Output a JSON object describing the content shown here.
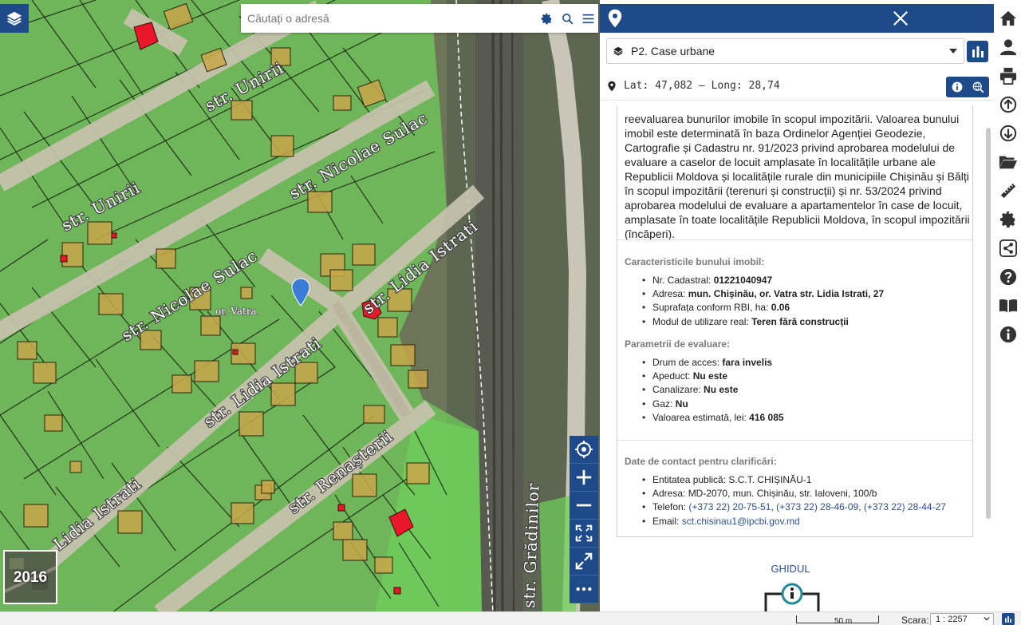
{
  "search": {
    "placeholder": "Căutați o adresă"
  },
  "map": {
    "streets": {
      "unirii_1": "str. Unirii",
      "unirii_2": "str. Unirii",
      "sulac_1": "str. Nicolae Sulac",
      "sulac_2": "str. Nicolae Sulac",
      "istrati_1": "str. Lidia Istrati",
      "istrati_2": "str. Lidia Istrati",
      "istrati_3": "Lidia Istrati",
      "renasterii": "str. Renașterii",
      "gradinilor": "str. Grădinilor"
    },
    "locality_label": "or. Vatra",
    "year_thumb": "2016"
  },
  "panel": {
    "layer_select": "P2. Case urbane",
    "coordinates": "Lat: 47,082 – Long: 28,74",
    "intro_text": "reevaluarea bunurilor imobile în scopul impozitării. Valoarea bunului imobil este determinată în baza Ordinelor Agenției Geodezie, Cartografie și Cadastru nr. 91/2023 privind aprobarea modelului de evaluare a caselor de locuit amplasate în localitățile urbane ale Republicii Moldova și localitățile rurale din municipiile Chișinău și Bălți în scopul impozitării (terenuri și construcții) și nr. 53/2024 privind aprobarea modelului de evaluare a apartamentelor în case de locuit, amplasate în toate localitățile Republicii Moldova, în scopul impozitării (încăperi).",
    "characteristics": {
      "title": "Caracteristicile bunului imobil:",
      "nr_label": "Nr. Cadastral: ",
      "nr_value": "01221040947",
      "address_label": "Adresa: ",
      "address_value": "mun. Chișinău, or. Vatra str. Lidia Istrati, 27",
      "area_label": "Suprafața conform RBI, ha: ",
      "area_value": "0.06",
      "use_label": "Modul de utilizare real: ",
      "use_value": "Teren fără construcții"
    },
    "evaluation": {
      "title": "Parametrii de evaluare:",
      "access_label": "Drum de acces: ",
      "access_value": "fara invelis",
      "water_label": "Apeduct: ",
      "water_value": "Nu este",
      "sewer_label": "Canalizare: ",
      "sewer_value": "Nu este",
      "gas_label": "Gaz: ",
      "gas_value": "Nu",
      "value_label": "Valoarea estimată, lei: ",
      "value_value": "416 085"
    },
    "contact": {
      "title": "Date de contact pentru clarificări:",
      "entity": "Entitatea publică: S.C.T. CHIȘINĂU-1",
      "address": "Adresa: MD-2070, mun. Chișinău, str. Ialoveni, 100/b",
      "phone_label": "Telefon: ",
      "phone_1": "(+373 22) 20-75-51",
      "phone_2": "(+373 22) 28-46-09",
      "phone_3": "(+373 22) 28-44-27",
      "sep": ", ",
      "email_label": "Email: ",
      "email": "sct.chisinau1@ipcbi.gov.md"
    },
    "guide": "GHIDUL"
  },
  "bottom": {
    "scale_text": "50 m",
    "scara_label": "Scara:",
    "scara_value": "1 : 2257"
  },
  "colors": {
    "primary": "#1f4a8a",
    "parcel_fill": "#6fd05a",
    "building_fill": "#c9a64a",
    "highlight_building": "#e8182a"
  },
  "icons": [
    "layers-icon",
    "gear-icon",
    "search-icon",
    "menu-icon",
    "map-pin-icon",
    "close-icon",
    "chevron-down-icon",
    "bar-chart-icon",
    "info-icon",
    "locate-icon",
    "plus-icon",
    "minus-icon",
    "fit-extent-icon",
    "fullscreen-icon",
    "more-icon",
    "home-icon",
    "user-icon",
    "print-icon",
    "upload-icon",
    "download-icon",
    "folder-icon",
    "ruler-icon",
    "settings-icon",
    "share-icon",
    "help-icon",
    "book-icon"
  ]
}
